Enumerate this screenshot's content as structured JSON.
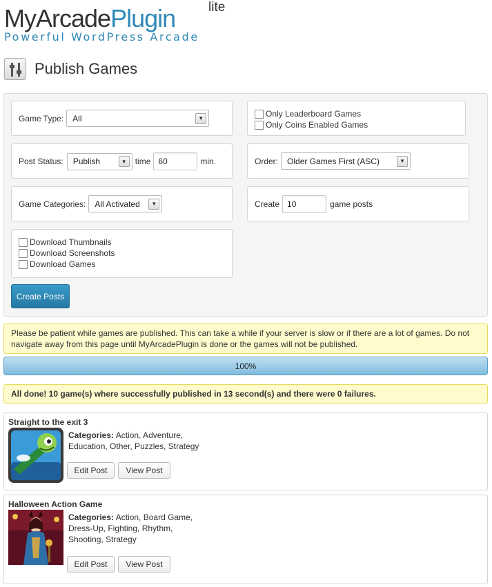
{
  "logo": {
    "part1": "MyArcade",
    "part2": "Plugin",
    "lite": "lite",
    "tagline": "Powerful WordPress Arcade"
  },
  "page": {
    "title": "Publish Games"
  },
  "form": {
    "game_type": {
      "label": "Game Type:",
      "value": "All"
    },
    "post_status": {
      "label": "Post Status:",
      "value": "Publish",
      "time_label": "time",
      "time_value": "60",
      "unit": "min."
    },
    "game_categories": {
      "label": "Game Categories:",
      "value": "All Activated"
    },
    "downloads": [
      "Download Thumbnails",
      "Download Screenshots",
      "Download Games"
    ],
    "only_options": [
      "Only Leaderboard Games",
      "Only Coins Enabled Games"
    ],
    "order": {
      "label": "Order:",
      "value": "Older Games First (ASC)"
    },
    "create": {
      "label": "Create",
      "value": "10",
      "suffix": "game posts"
    },
    "submit_label": "Create Posts"
  },
  "notice": "Please be patient while games are published. This can take a while if your server is slow or if there are a lot of games. Do not navigate away from this page until MyArcadePlugin is done or the games will not be published.",
  "progress": {
    "label": "100%",
    "percent": 100
  },
  "done_message": "All done! 10 game(s) where successfully published in 13 second(s) and there were 0 failures.",
  "games": [
    {
      "title": "Straight to the exit 3",
      "categories_label": "Categories:",
      "categories": "Action, Adventure, Education, Other, Puzzles, Strategy",
      "edit_label": "Edit Post",
      "view_label": "View Post"
    },
    {
      "title": "Halloween Action Game",
      "categories_label": "Categories:",
      "categories": "Action, Board Game, Dress-Up, Fighting, Rhythm, Shooting, Strategy",
      "edit_label": "Edit Post",
      "view_label": "View Post"
    }
  ],
  "colors": {
    "brand": "#2f88b7",
    "button": "#2578a3",
    "notice_bg": "#fffbcc",
    "notice_border": "#e6db55"
  }
}
